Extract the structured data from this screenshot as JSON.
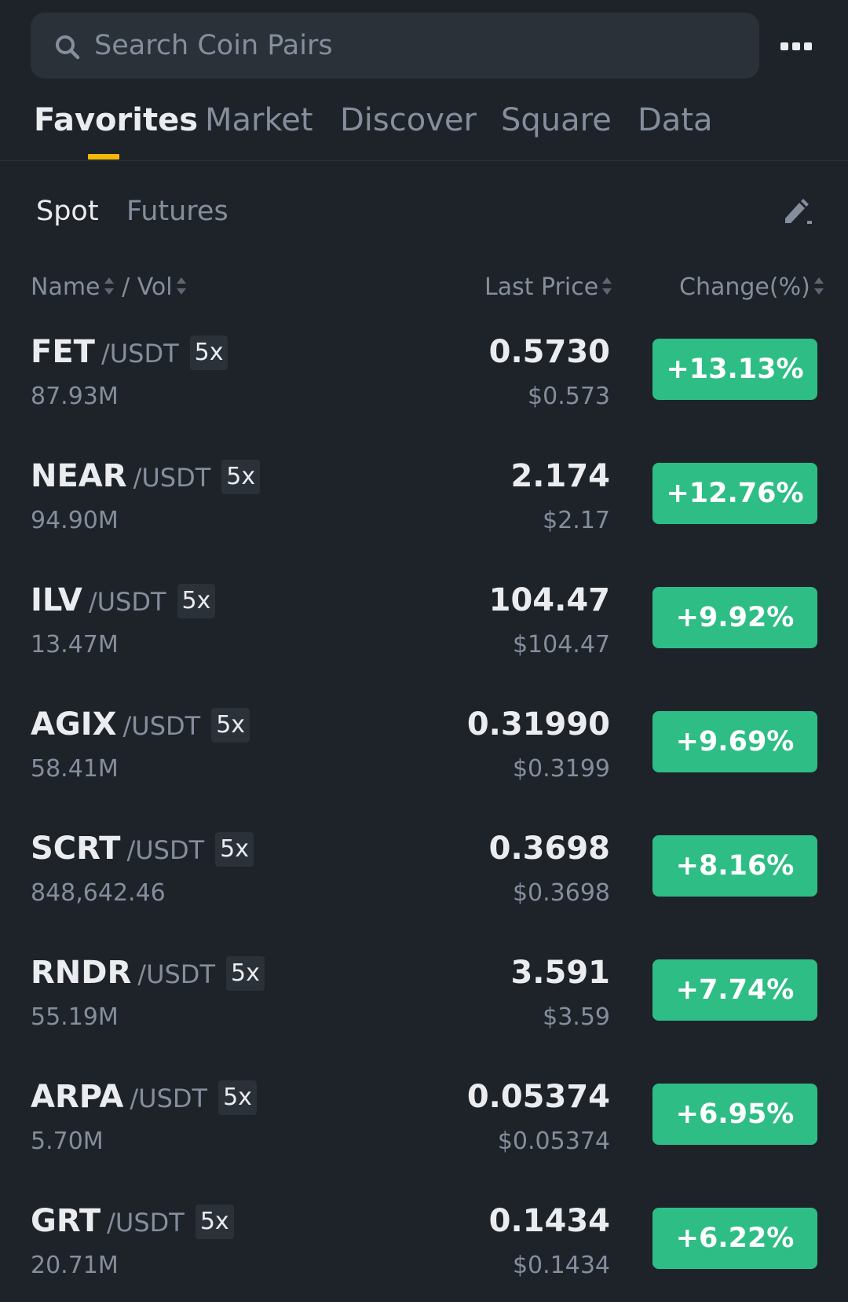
{
  "search": {
    "placeholder": "Search Coin Pairs"
  },
  "main_tabs": [
    "Favorites",
    "Market",
    "Discover",
    "Square",
    "Data"
  ],
  "sub_tabs": [
    "Spot",
    "Futures"
  ],
  "columns": {
    "name": "Name",
    "vol": "/ Vol",
    "last_price": "Last Price",
    "change": "Change(%)"
  },
  "colors": {
    "accent": "#f0b90b",
    "positive": "#2ebd85",
    "background": "#1e2329",
    "muted": "#848e9c"
  },
  "pairs": [
    {
      "base": "FET",
      "quote": "/USDT",
      "leverage": "5x",
      "volume": "87.93M",
      "price": "0.5730",
      "usd": "$0.573",
      "change": "+13.13%"
    },
    {
      "base": "NEAR",
      "quote": "/USDT",
      "leverage": "5x",
      "volume": "94.90M",
      "price": "2.174",
      "usd": "$2.17",
      "change": "+12.76%"
    },
    {
      "base": "ILV",
      "quote": "/USDT",
      "leverage": "5x",
      "volume": "13.47M",
      "price": "104.47",
      "usd": "$104.47",
      "change": "+9.92%"
    },
    {
      "base": "AGIX",
      "quote": "/USDT",
      "leverage": "5x",
      "volume": "58.41M",
      "price": "0.31990",
      "usd": "$0.3199",
      "change": "+9.69%"
    },
    {
      "base": "SCRT",
      "quote": "/USDT",
      "leverage": "5x",
      "volume": "848,642.46",
      "price": "0.3698",
      "usd": "$0.3698",
      "change": "+8.16%"
    },
    {
      "base": "RNDR",
      "quote": "/USDT",
      "leverage": "5x",
      "volume": "55.19M",
      "price": "3.591",
      "usd": "$3.59",
      "change": "+7.74%"
    },
    {
      "base": "ARPA",
      "quote": "/USDT",
      "leverage": "5x",
      "volume": "5.70M",
      "price": "0.05374",
      "usd": "$0.05374",
      "change": "+6.95%"
    },
    {
      "base": "GRT",
      "quote": "/USDT",
      "leverage": "5x",
      "volume": "20.71M",
      "price": "0.1434",
      "usd": "$0.1434",
      "change": "+6.22%"
    }
  ]
}
